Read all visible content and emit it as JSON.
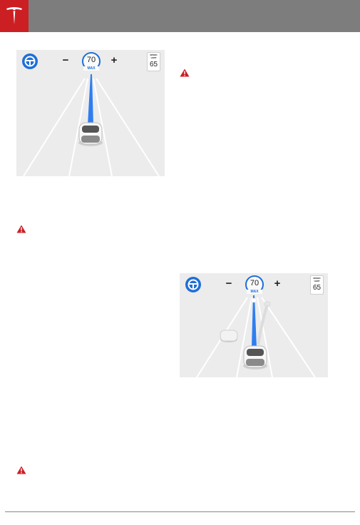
{
  "header": {
    "brand_icon": "tesla-logo-icon",
    "brand_color": "#cc1f24",
    "bar_color": "#7d7d7d"
  },
  "warnings": {
    "icon": "warning-triangle-icon",
    "color": "#cc1f24"
  },
  "screens": [
    {
      "steering_icon": "steering-wheel-icon",
      "minus": "−",
      "set_speed": "70",
      "set_speed_unit": "MAX",
      "plus": "+",
      "speed_limit_label": "SPEED\nLIMIT",
      "speed_limit": "65"
    },
    {
      "steering_icon": "steering-wheel-icon",
      "minus": "−",
      "set_speed": "70",
      "set_speed_unit": "MAX",
      "plus": "+",
      "speed_limit_label": "SPEED\nLIMIT",
      "speed_limit": "65"
    }
  ],
  "accent_color": "#1f6fd6"
}
